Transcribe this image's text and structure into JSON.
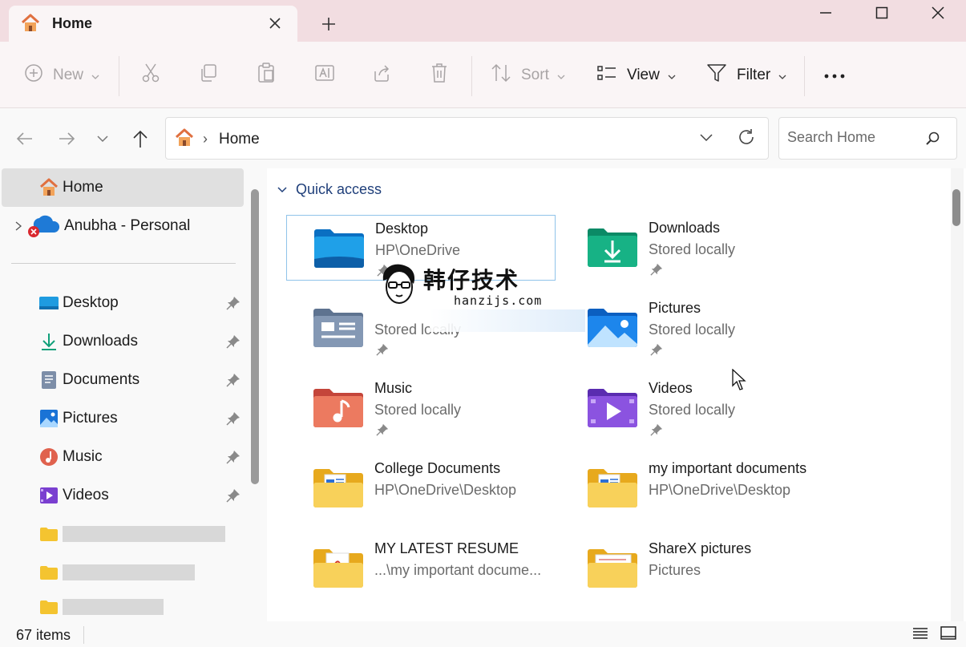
{
  "tab": {
    "title": "Home"
  },
  "toolbar": {
    "new_label": "New",
    "sort_label": "Sort",
    "view_label": "View",
    "filter_label": "Filter"
  },
  "address": {
    "crumb": "Home",
    "search_placeholder": "Search Home"
  },
  "sidebar": {
    "home": "Home",
    "account": "Anubha - Personal",
    "items": [
      {
        "label": "Desktop",
        "icon": "desktop-icon"
      },
      {
        "label": "Downloads",
        "icon": "downloads-icon"
      },
      {
        "label": "Documents",
        "icon": "documents-icon"
      },
      {
        "label": "Pictures",
        "icon": "pictures-icon"
      },
      {
        "label": "Music",
        "icon": "music-icon"
      },
      {
        "label": "Videos",
        "icon": "videos-icon"
      }
    ]
  },
  "main": {
    "section_title": "Quick access",
    "tiles": [
      {
        "name": "Desktop",
        "sub": "HP\\OneDrive"
      },
      {
        "name": "Downloads",
        "sub": "Stored locally"
      },
      {
        "name": "",
        "sub": "Stored locally"
      },
      {
        "name": "Pictures",
        "sub": "Stored locally"
      },
      {
        "name": "Music",
        "sub": "Stored locally"
      },
      {
        "name": "Videos",
        "sub": "Stored locally"
      },
      {
        "name": "College Documents",
        "sub": "HP\\OneDrive\\Desktop"
      },
      {
        "name": "my important documents",
        "sub": "HP\\OneDrive\\Desktop"
      },
      {
        "name": "MY LATEST RESUME",
        "sub": "...\\my important docume..."
      },
      {
        "name": "ShareX pictures",
        "sub": "Pictures"
      }
    ]
  },
  "watermark": {
    "title": "韩仔技术",
    "url": "hanzijs.com"
  },
  "status": {
    "count": "67 items"
  },
  "colors": {
    "accent": "#1f3f7a",
    "tab_bar": "#f2dde1",
    "selection": "#90c3ea"
  }
}
